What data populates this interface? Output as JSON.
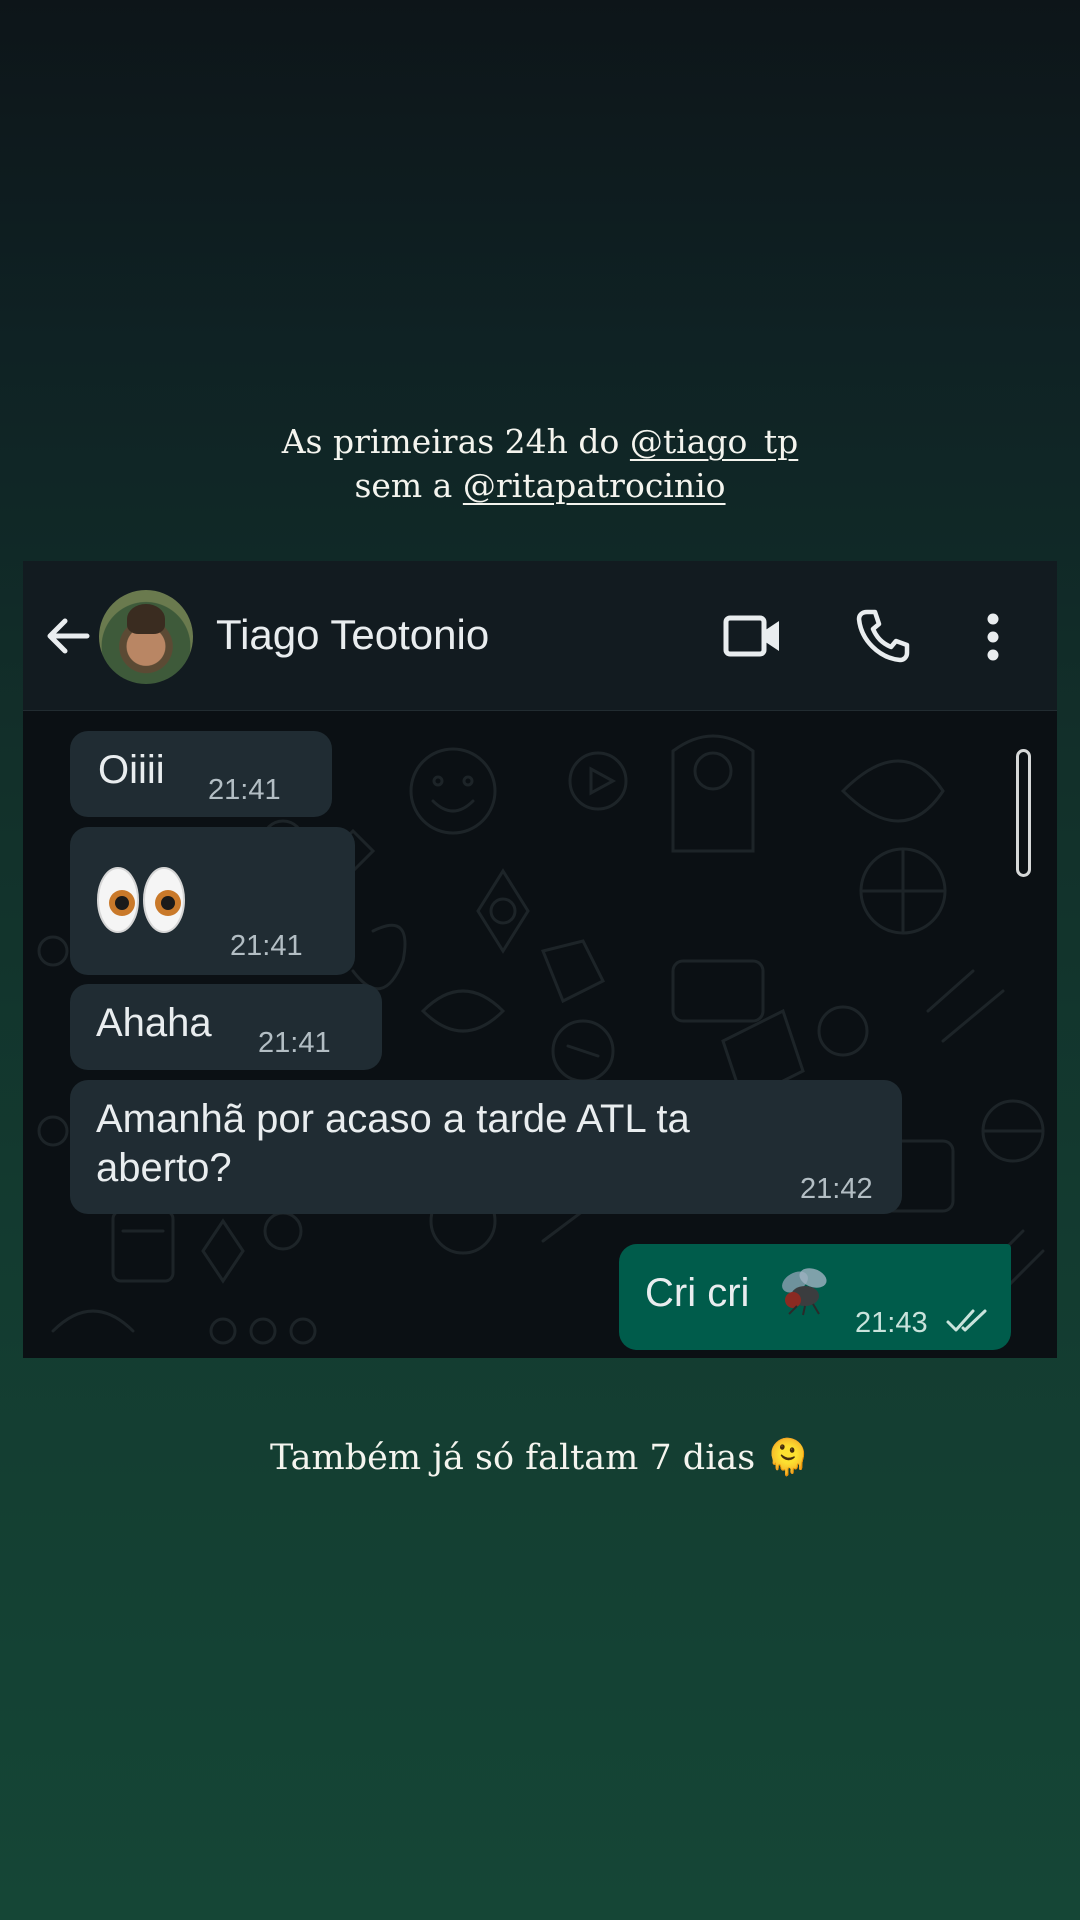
{
  "caption_top": {
    "line1_prefix": "As primeiras 24h do ",
    "line1_mention": "@tiago_tp",
    "line2_prefix": "sem a ",
    "line2_mention": "@ritapatrocinio"
  },
  "caption_bottom": {
    "text": "Também já só faltam 7 dias",
    "emoji": "🫠"
  },
  "chat": {
    "header": {
      "contact_name": "Tiago Teotonio",
      "icons": [
        "back-arrow-icon",
        "avatar",
        "video-call-icon",
        "voice-call-icon",
        "more-options-icon"
      ]
    },
    "messages": [
      {
        "direction": "incoming",
        "text": "Oiiii",
        "time": "21:41"
      },
      {
        "direction": "incoming",
        "text": "",
        "emoji": "eyes-emoji",
        "time": "21:41"
      },
      {
        "direction": "incoming",
        "text": "Ahaha",
        "time": "21:41"
      },
      {
        "direction": "incoming",
        "text_line1": "Amanhã por acaso a tarde ATL ta",
        "text_line2": "aberto?",
        "time": "21:42"
      },
      {
        "direction": "outgoing",
        "text": "Cri cri",
        "emoji": "fly-emoji",
        "time": "21:43",
        "status": "read-double-check"
      }
    ]
  },
  "colors": {
    "incoming_bubble": "#202c33",
    "outgoing_bubble": "#005c4b",
    "header_bg": "#121b20",
    "chat_bg": "#0b1014"
  }
}
